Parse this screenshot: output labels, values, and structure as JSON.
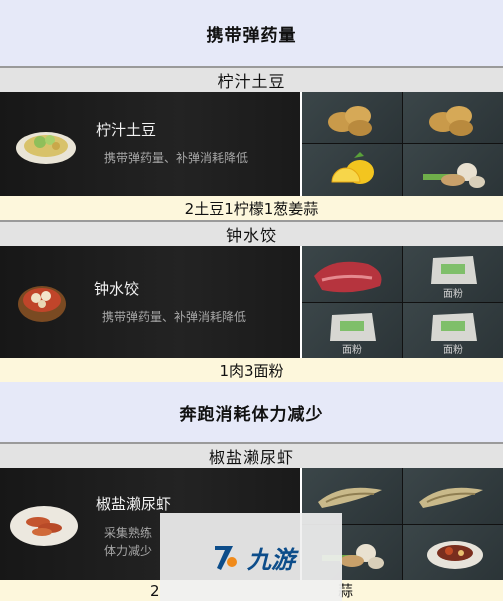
{
  "sections": [
    {
      "header": "携带弹药量",
      "recipes": [
        {
          "name": "柠汁土豆",
          "card_title": "柠汁土豆",
          "card_desc": "携带弹药量、补弹消耗降低",
          "formula": "2土豆1柠檬1葱姜蒜",
          "ingredients": [
            "potato",
            "potato",
            "lemon",
            "scallion-ginger-garlic"
          ]
        },
        {
          "name": "钟水饺",
          "card_title": "钟水饺",
          "card_desc": "携带弹药量、补弹消耗降低",
          "formula": "1肉3面粉",
          "ingredients": [
            "meat",
            "面粉",
            "面粉",
            "面粉"
          ]
        }
      ]
    },
    {
      "header": "奔跑消耗体力减少",
      "recipes": [
        {
          "name": "椒盐濑尿虾",
          "card_title": "椒盐濑尿虾",
          "card_desc_lines": [
            "采集熟练",
            "体力减少"
          ],
          "formula_left": "2",
          "formula_right": "蒜",
          "ingredients": [
            "mantis-shrimp",
            "mantis-shrimp",
            "scallion-ginger-garlic",
            "plated-dish"
          ]
        }
      ]
    }
  ],
  "watermark": {
    "text": "九游"
  },
  "colors": {
    "header_bg": "#e6e9f8",
    "name_bg": "#e3e3e3",
    "formula_bg": "#fdf7dc",
    "card_bg": "#1b1b1b"
  }
}
